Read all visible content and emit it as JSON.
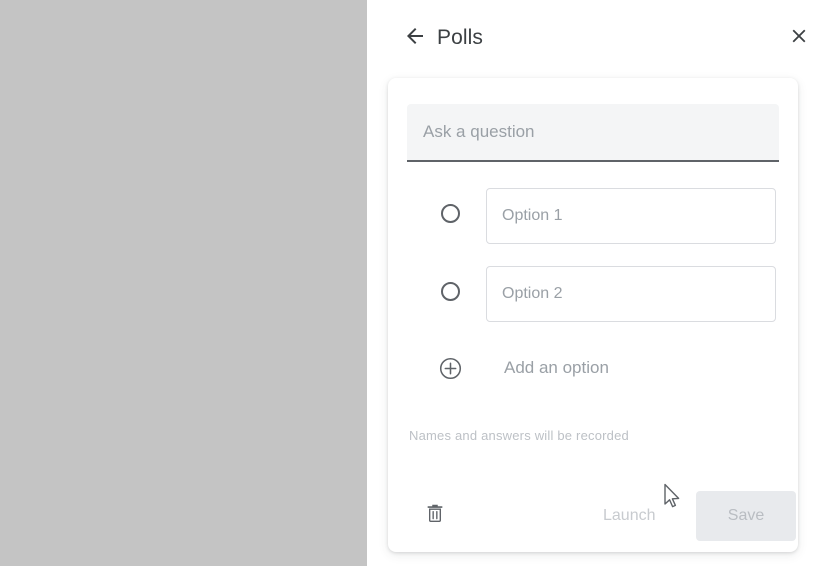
{
  "backdrop": {
    "color": "#c4c4c4"
  },
  "header": {
    "title": "Polls",
    "back_icon": "arrow-left-icon",
    "close_icon": "close-icon"
  },
  "card": {
    "question": {
      "value": "",
      "placeholder": "Ask a question"
    },
    "options": [
      {
        "value": "",
        "placeholder": "Option 1",
        "radio_icon": "radio-unchecked-icon"
      },
      {
        "value": "",
        "placeholder": "Option 2",
        "radio_icon": "radio-unchecked-icon"
      }
    ],
    "add_option": {
      "label": "Add an option",
      "icon": "plus-circle-icon"
    },
    "notice": "Names and answers will be recorded",
    "footer": {
      "delete_icon": "trash-icon",
      "launch_label": "Launch",
      "save_label": "Save"
    }
  },
  "colors": {
    "text_primary": "#3c4043",
    "text_placeholder": "#9aa0a6",
    "text_disabled": "#c8cbcf",
    "field_fill": "#f4f5f6",
    "button_fill": "#e8eaed",
    "border": "#dadce0"
  }
}
